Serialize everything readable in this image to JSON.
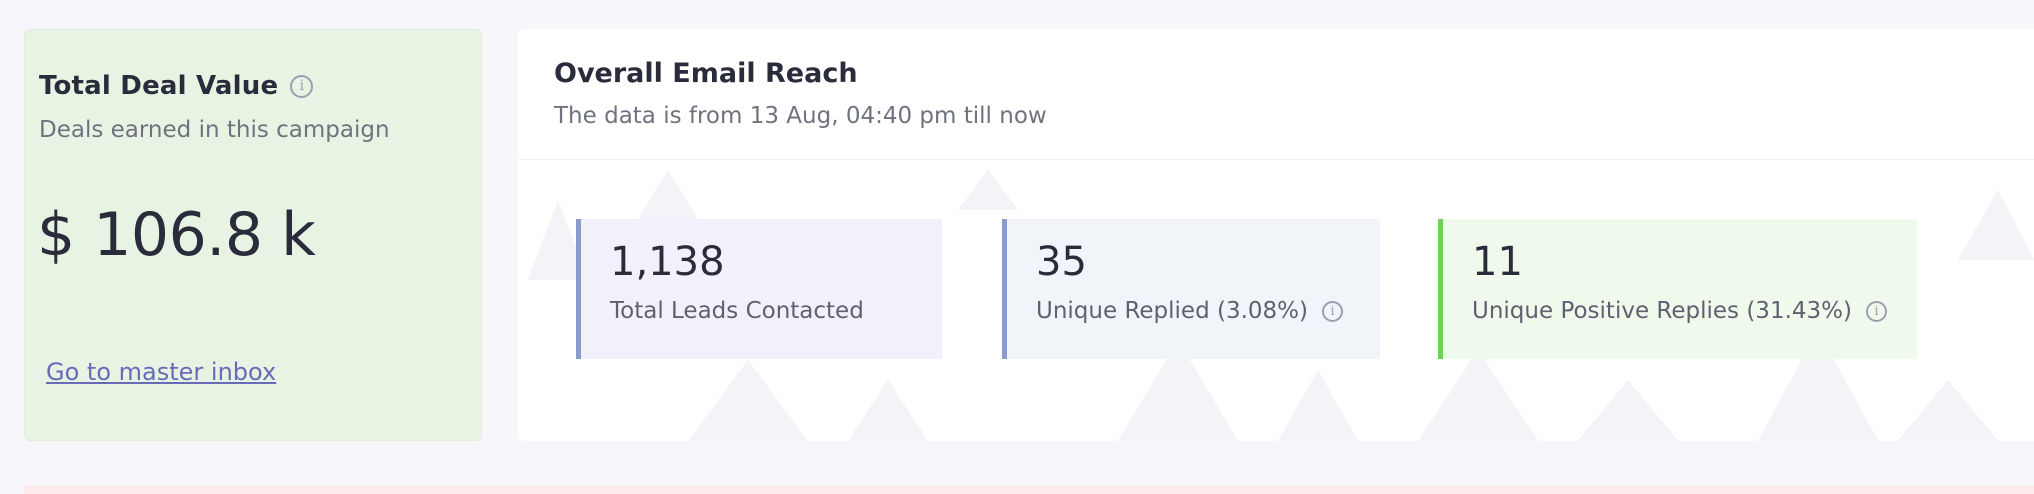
{
  "deal_card": {
    "title": "Total Deal Value",
    "title_icon": "info-icon",
    "subtitle": "Deals earned in this campaign",
    "value": "$ 106.8 k",
    "link_label": "Go to master inbox"
  },
  "reach_card": {
    "title": "Overall Email Reach",
    "subtitle": "The data is from 13 Aug, 04:40 pm till now",
    "stats": [
      {
        "value": "1,138",
        "label": "Total Leads Contacted"
      },
      {
        "value": "35",
        "label": "Unique Replied (3.08%)",
        "icon": "info-icon"
      },
      {
        "value": "11",
        "label": "Unique Positive Replies (31.43%)",
        "icon": "info-icon"
      }
    ]
  },
  "colors": {
    "deal_card_bg": "#e7f3e3",
    "leads_accent": "#8a9ccc",
    "positive_accent": "#6dd15a",
    "link": "#6a6bb8"
  }
}
